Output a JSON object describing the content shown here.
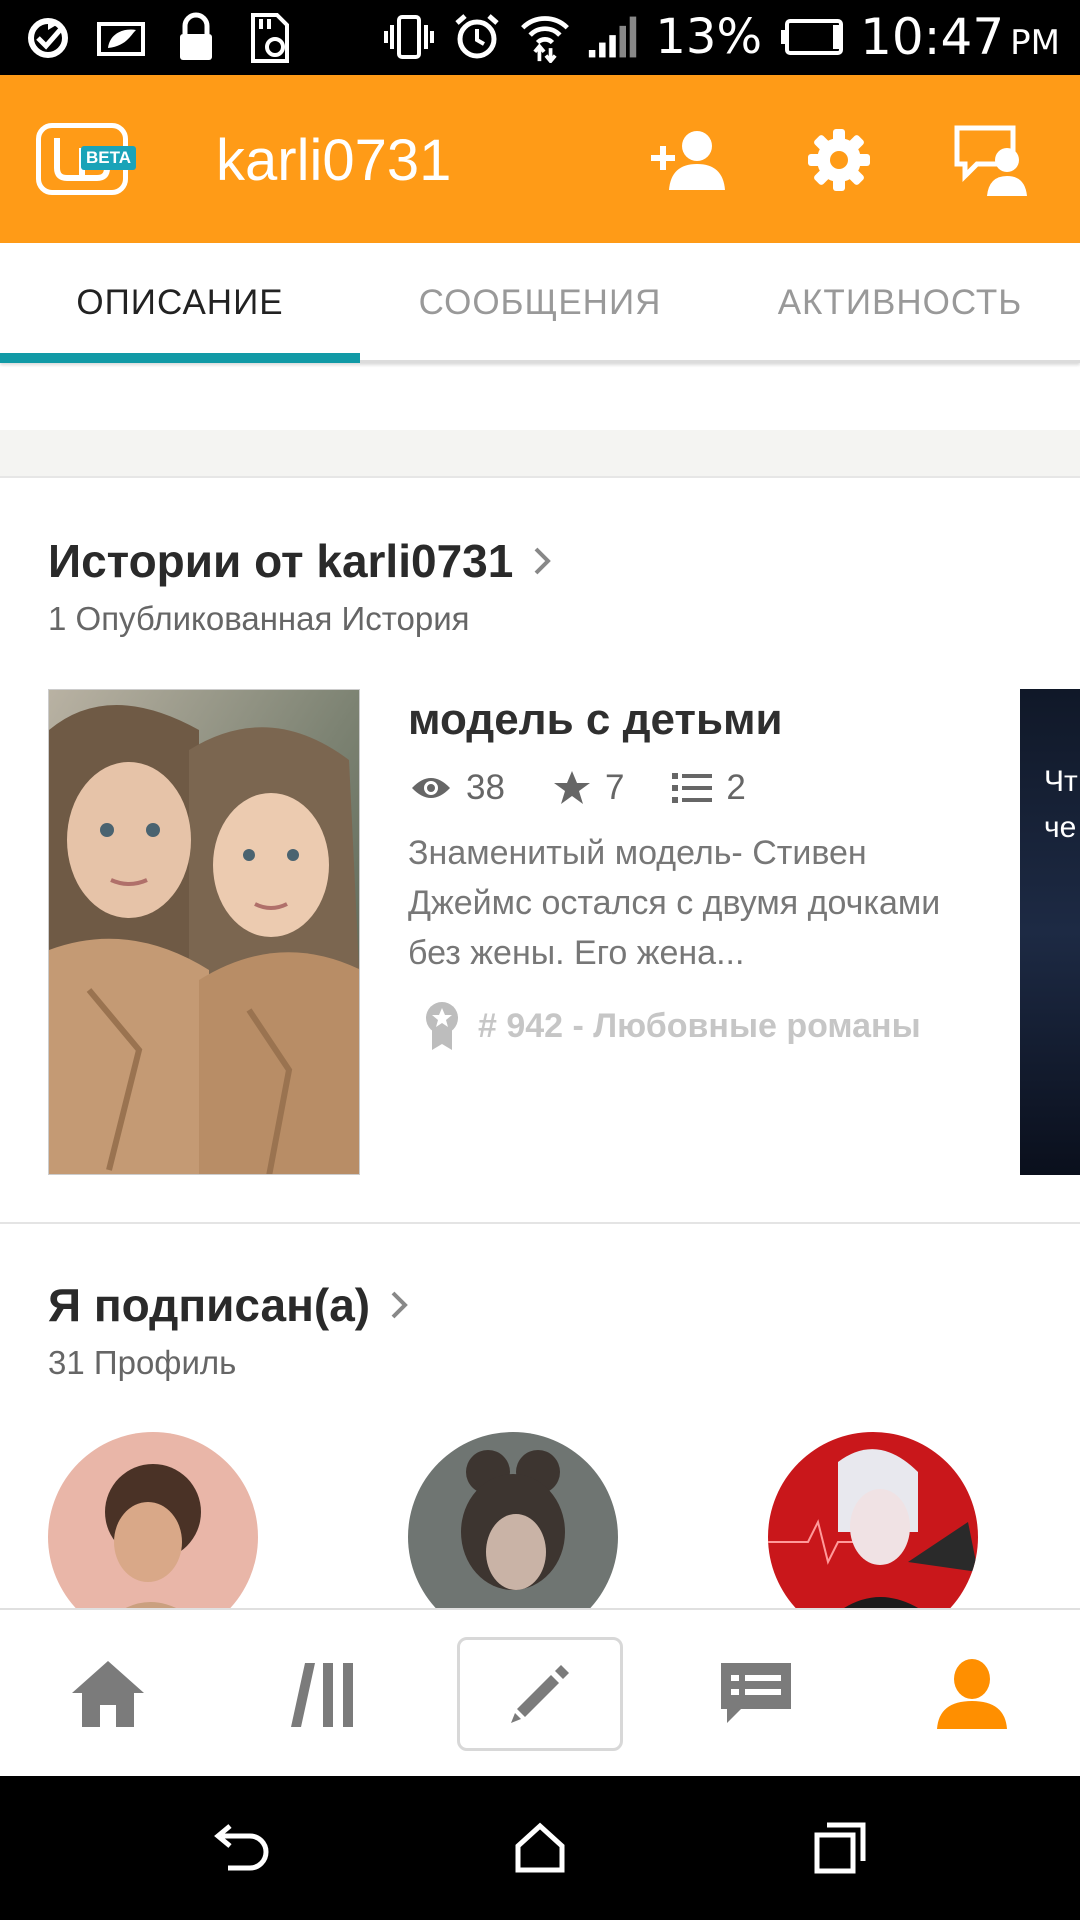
{
  "status_bar": {
    "battery_percent": "13%",
    "time": "10:47",
    "ampm": "PM"
  },
  "app_bar": {
    "logo_badge": "BETA",
    "username": "karli0731",
    "actions": [
      "add-friend-icon",
      "settings-icon",
      "message-icon"
    ]
  },
  "tabs": [
    {
      "label": "ОПИСАНИЕ",
      "active": true
    },
    {
      "label": "СООБЩЕНИЯ",
      "active": false
    },
    {
      "label": "АКТИВНОСТЬ",
      "active": false
    }
  ],
  "stories": {
    "heading": "Истории от karli0731",
    "count_label": "1 Опубликованная История",
    "items": [
      {
        "title": "модель с детьми",
        "reads": "38",
        "votes": "7",
        "parts": "2",
        "description": "Знаменитый модель- Стивен Джеймс остался с двумя дочками без жены. Его жена...",
        "rank": "# 942 - Любовные романы"
      }
    ],
    "next_peek_text": "Чт\nче"
  },
  "following": {
    "heading": "Я подписан(а)",
    "count_label": "31 Профиль"
  },
  "bottom_nav": {
    "items": [
      "home-icon",
      "library-icon",
      "write-icon",
      "messages-icon",
      "profile-icon"
    ],
    "active": "profile-icon"
  },
  "colors": {
    "brand_orange": "#ff9b17",
    "tab_indicator": "#119aa6"
  }
}
